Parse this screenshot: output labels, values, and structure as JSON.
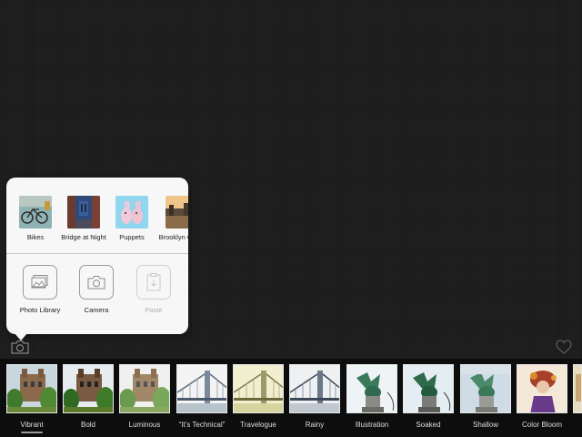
{
  "source_picker": {
    "recent_items": [
      {
        "label": "Bikes"
      },
      {
        "label": "Bridge at Night"
      },
      {
        "label": "Puppets"
      },
      {
        "label": "Brooklyn Canal"
      }
    ],
    "actions": [
      {
        "label": "Photo Library",
        "icon": "photo-library-icon",
        "enabled": true
      },
      {
        "label": "Camera",
        "icon": "camera-icon",
        "enabled": true
      },
      {
        "label": "Paste",
        "icon": "paste-icon",
        "enabled": false
      }
    ]
  },
  "toolbar": {
    "left_icon": "camera-icon",
    "right_icon": "heart-icon"
  },
  "filters": {
    "selected": "Vibrant",
    "items": [
      {
        "label": "Vibrant"
      },
      {
        "label": "Bold"
      },
      {
        "label": "Luminous"
      },
      {
        "label": "“It’s Technical”"
      },
      {
        "label": "Travelogue"
      },
      {
        "label": "Rainy"
      },
      {
        "label": "Illustration"
      },
      {
        "label": "Soaked"
      },
      {
        "label": "Shallow"
      },
      {
        "label": "Color Bloom"
      }
    ]
  },
  "colors": {
    "background": "#1b1b1b",
    "popover": "#f7f7f7",
    "strip": "#0d0d0d"
  }
}
